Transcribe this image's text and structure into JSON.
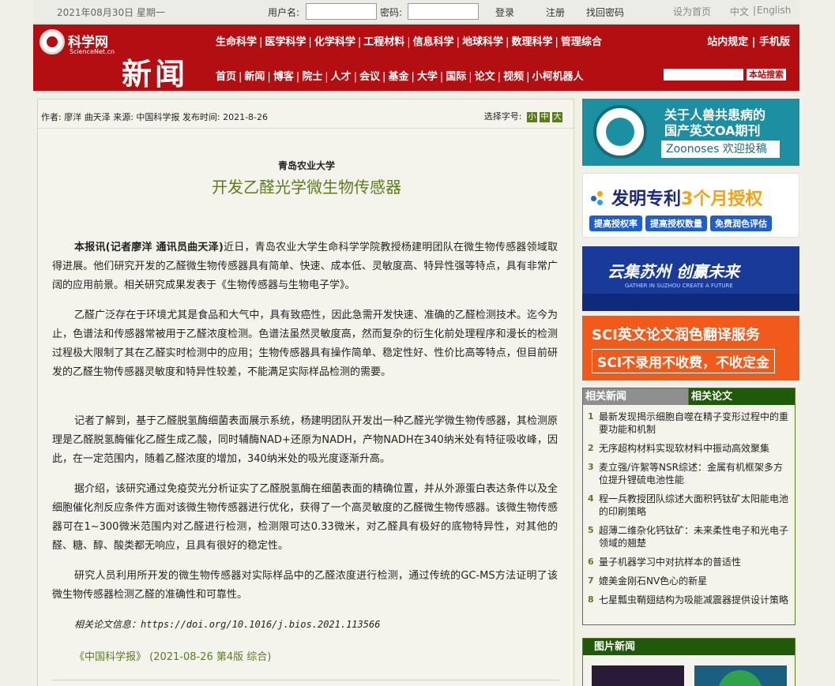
{
  "topbar": {
    "date": "2021年08月30日 星期一",
    "username_label": "用户名:",
    "password_label": "密码:",
    "login": "登录",
    "register": "注册",
    "retrieve_password": "找回密码",
    "set_homepage": "设为首页",
    "lang_zh": "中文",
    "lang_sep": "|",
    "lang_en": "English"
  },
  "header": {
    "logo_name": "科学网",
    "logo_domain": "ScienceNet.cn",
    "news_word": "新闻",
    "nav1": [
      "生命科学",
      "医学科学",
      "化学科学",
      "工程材料",
      "信息科学",
      "地球科学",
      "数理科学",
      "管理综合"
    ],
    "nav2": [
      "首页",
      "新闻",
      "博客",
      "院士",
      "人才",
      "会议",
      "基金",
      "大学",
      "国际",
      "论文",
      "视频",
      "小柯机器人"
    ],
    "nav_right": "站内规定 | 手机版",
    "search_button": "本站搜索"
  },
  "article": {
    "meta": "作者: 廖洋 曲天泽 来源: 中国科学报 发布时间: 2021-8-26",
    "font_size_label": "选择字号:",
    "font_sizes": [
      "小",
      "中",
      "大"
    ],
    "subtitle": "青岛农业大学",
    "headline": "开发乙醛光学微生物传感器",
    "p1_lead": "本报讯(记者廖洋 通讯员曲天泽)",
    "p1_body": "近日，青岛农业大学生命科学学院教授杨建明团队在微生物传感器领域取得进展。他们研究开发的乙醛微生物传感器具有简单、快速、成本低、灵敏度高、特异性强等特点，具有非常广阔的应用前景。相关研究成果发表于《生物传感器与生物电子学》。",
    "p2": "乙醛广泛存在于环境尤其是食品和大气中，具有致癌性，因此急需开发快速、准确的乙醛检测技术。迄今为止，色谱法和传感器常被用于乙醛浓度检测。色谱法虽然灵敏度高，然而复杂的衍生化前处理程序和漫长的检测过程极大限制了其在乙醛实时检测中的应用；生物传感器具有操作简单、稳定性好、性价比高等特点，但目前研发的乙醛生物传感器灵敏度和特异性较差，不能满足实际样品检测的需要。",
    "p3": "记者了解到，基于乙醛脱氢酶细菌表面展示系统，杨建明团队开发出一种乙醛光学微生物传感器，其检测原理是乙醛脱氢酶催化乙醛生成乙酸，同时辅酶NAD+还原为NADH，产物NADH在340纳米处有特征吸收峰，因此，在一定范围内，随着乙醛浓度的增加，340纳米处的吸光度逐渐升高。",
    "p4": "据介绍，该研究通过免疫荧光分析证实了乙醛脱氢酶在细菌表面的精确位置，并从外源蛋白表达条件以及全细胞催化剂反应条件方面对该微生物传感器进行优化，获得了一个高灵敏度的乙醛微生物传感器。该微生物传感器可在1~300微米范围内对乙醛进行检测，检测限可达0.33微米，对乙醛具有极好的底物特异性，对其他的醛、糖、醇、酸类都无响应，且具有很好的稳定性。",
    "p5": "研究人员利用所开发的微生物传感器对实际样品中的乙醛浓度进行检测，通过传统的GC-MS方法证明了该微生物传感器检测乙醛的准确性和可靠性。",
    "related_paper": "相关论文信息：https://doi.org/10.1016/j.bios.2021.113566",
    "source": "《中国科学报》 (2021-08-26 第4版 综合)"
  },
  "ads": {
    "ad1_line1": "关于人兽共患病的",
    "ad1_line2": "国产英文OA期刊",
    "ad1_badge": "Zoonoses 欢迎投稿",
    "ad2_title_a": "发明专利",
    "ad2_title_b": "3个月授权",
    "ad2_buttons": [
      "提高授权率",
      "提高授权数量",
      "免费润色评估"
    ],
    "ad3_title": "云集苏州 创赢未来",
    "ad3_sub": "GATHER IN SUZHOU CREATE A FUTURE",
    "ad4_line1": "SCI英文论文润色翻译服务",
    "ad4_line2": "SCI不录用不收费，不收定金"
  },
  "related": {
    "tab_news": "相关新闻",
    "tab_papers": "相关论文",
    "items": [
      "最新发现揭示细胞自噬在精子变形过程中的重要功能和机制",
      "无序超构材料实现软材料中振动高效聚集",
      "麦立强/许絮等NSR综述：金属有机框架多方位提升锂硫电池性能",
      "程一兵教授团队综述大面积钙钛矿太阳能电池的印刷策略",
      "超薄二维杂化钙钛矿：未来柔性电子和光电子领域的翘楚",
      "量子机器学习中对抗样本的普适性",
      "媲美金刚石NV色心的新星",
      "七星瓢虫鞘翅结构为吸能减震器提供设计策略"
    ]
  },
  "pic_news": {
    "title": "图片新闻"
  }
}
